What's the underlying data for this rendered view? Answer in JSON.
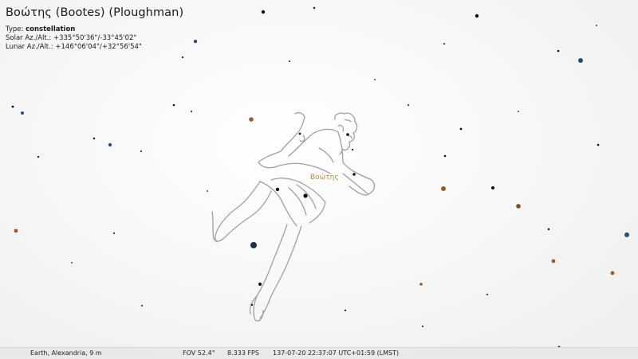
{
  "object_info": {
    "title": "Βοώτης (Bootes) (Ploughman)",
    "type_label": "Type:",
    "type_value": "constellation",
    "solar_label": "Solar Az./Alt.:",
    "solar_value": "+335°50'36\"/-33°45'02\"",
    "lunar_label": "Lunar Az./Alt.:",
    "lunar_value": "+146°06'04\"/+32°56'54\""
  },
  "constellation_label": "Βοώτης",
  "status_bar": {
    "location": "Earth, Alexandria, 9 m",
    "fov": "FOV 52.4°",
    "fps": "8.333 FPS",
    "datetime": "137-07-20 22:37:07 UTC+01:59 (LMST)"
  },
  "colors": {
    "label": "#b58a4a",
    "artwork_line": "#9a9a9a",
    "star": "#111111",
    "star_blue": "#2b4d7a",
    "star_orange": "#9a5a2a"
  }
}
